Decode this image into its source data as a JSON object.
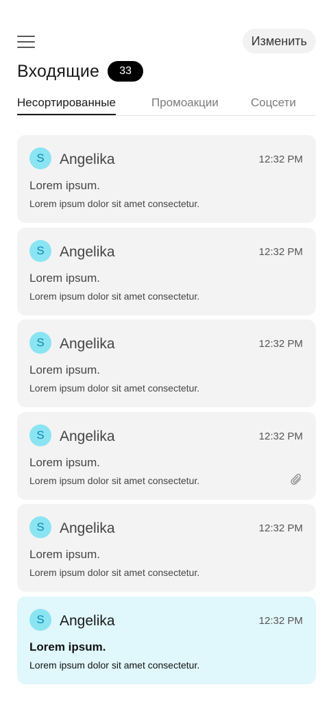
{
  "header": {
    "menu_icon": "hamburger-menu-icon",
    "edit_label": "Изменить",
    "title": "Входящие",
    "count": "33"
  },
  "tabs": [
    {
      "label": "Несортированные",
      "active": true
    },
    {
      "label": "Промоакции",
      "active": false
    },
    {
      "label": "Соцсети",
      "active": false
    }
  ],
  "emails": [
    {
      "avatar": "S",
      "sender": "Angelika",
      "time": "12:32 PM",
      "subject": "Lorem ipsum.",
      "preview": "Lorem ipsum dolor sit amet consectetur.",
      "attachment": false,
      "unread": false
    },
    {
      "avatar": "S",
      "sender": "Angelika",
      "time": "12:32 PM",
      "subject": "Lorem ipsum.",
      "preview": "Lorem ipsum dolor sit amet consectetur.",
      "attachment": false,
      "unread": false
    },
    {
      "avatar": "S",
      "sender": "Angelika",
      "time": "12:32 PM",
      "subject": "Lorem ipsum.",
      "preview": "Lorem ipsum dolor sit amet consectetur.",
      "attachment": false,
      "unread": false
    },
    {
      "avatar": "S",
      "sender": "Angelika",
      "time": "12:32 PM",
      "subject": "Lorem ipsum.",
      "preview": "Lorem ipsum dolor sit amet consectetur.",
      "attachment": true,
      "unread": false
    },
    {
      "avatar": "S",
      "sender": "Angelika",
      "time": "12:32 PM",
      "subject": "Lorem ipsum.",
      "preview": "Lorem ipsum dolor sit amet consectetur.",
      "attachment": false,
      "unread": false
    },
    {
      "avatar": "S",
      "sender": "Angelika",
      "time": "12:32 PM",
      "subject": "Lorem ipsum.",
      "preview": "Lorem ipsum dolor sit amet consectetur.",
      "attachment": false,
      "unread": true
    }
  ],
  "colors": {
    "avatar_bg": "#8be4f2",
    "avatar_text": "#0a88b3",
    "card_bg": "#f3f3f3",
    "unread_card_bg": "#e0f7fc",
    "badge_bg": "#000000"
  }
}
